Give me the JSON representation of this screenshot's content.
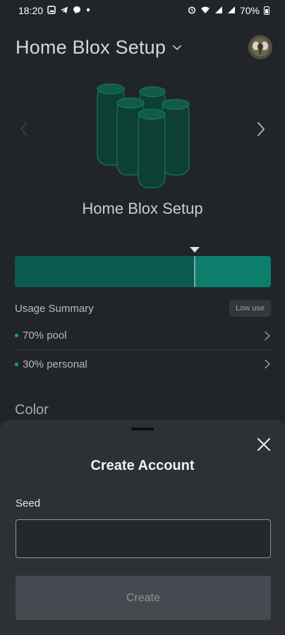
{
  "status_bar": {
    "time": "18:20",
    "battery": "70%",
    "icons": [
      "image-icon",
      "telegram-icon",
      "chat-icon",
      "dot-icon",
      "alarm-icon",
      "wifi-icon",
      "signal-icon",
      "signal-icon",
      "battery-icon"
    ]
  },
  "header": {
    "title": "Home Blox Setup"
  },
  "device": {
    "name": "Home Blox Setup"
  },
  "usage": {
    "fill_fraction": 0.7,
    "summary_title": "Usage Summary",
    "badge": "Low use",
    "items": [
      {
        "label": "70% pool"
      },
      {
        "label": "30% personal"
      }
    ]
  },
  "sections": {
    "color_title": "Color"
  },
  "sheet": {
    "title": "Create Account",
    "seed_label": "Seed",
    "seed_value": "",
    "seed_placeholder": "",
    "create_label": "Create"
  },
  "colors": {
    "accent": "#0b7f6b",
    "accent_dark": "#0b5a52",
    "background": "#222528",
    "sheet": "#2d3034"
  }
}
